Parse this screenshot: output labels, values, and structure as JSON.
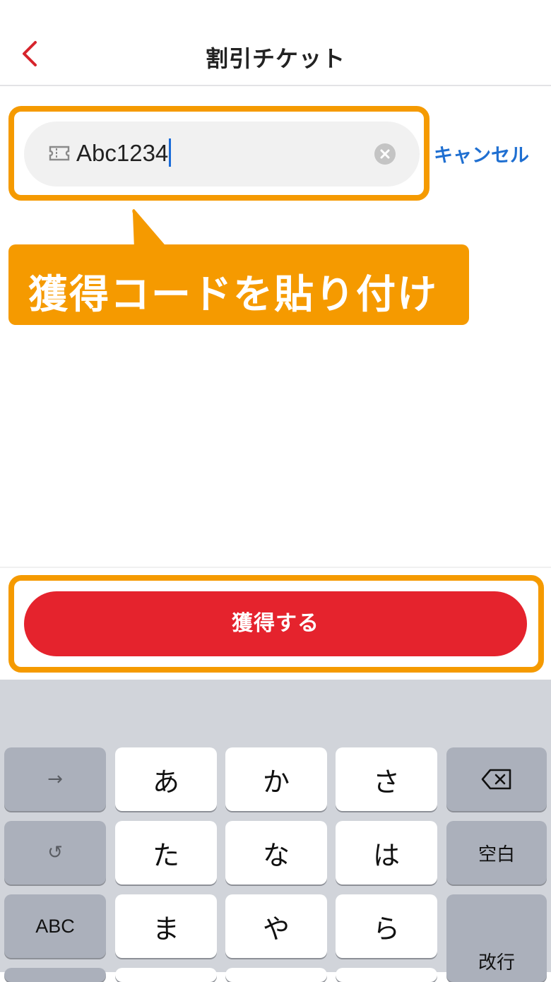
{
  "header": {
    "title": "割引チケット",
    "back_icon": "chevron-left-icon",
    "accent_color": "#d6242c"
  },
  "search": {
    "value": "Abc1234",
    "ticket_icon": "ticket-icon",
    "clear_icon": "clear-circle-icon",
    "cancel_label": "キャンセル"
  },
  "annotation": {
    "callout_text": "獲得コードを貼り付け",
    "highlight_color": "#f59a00"
  },
  "action": {
    "button_label": "獲得する",
    "button_color": "#e5232d"
  },
  "keyboard": {
    "row1": [
      "→",
      "あ",
      "か",
      "さ",
      "⌫"
    ],
    "row2": [
      "↺",
      "た",
      "な",
      "は",
      "空白"
    ],
    "row3": [
      "ABC",
      "ま",
      "や",
      "ら",
      "改行"
    ]
  }
}
